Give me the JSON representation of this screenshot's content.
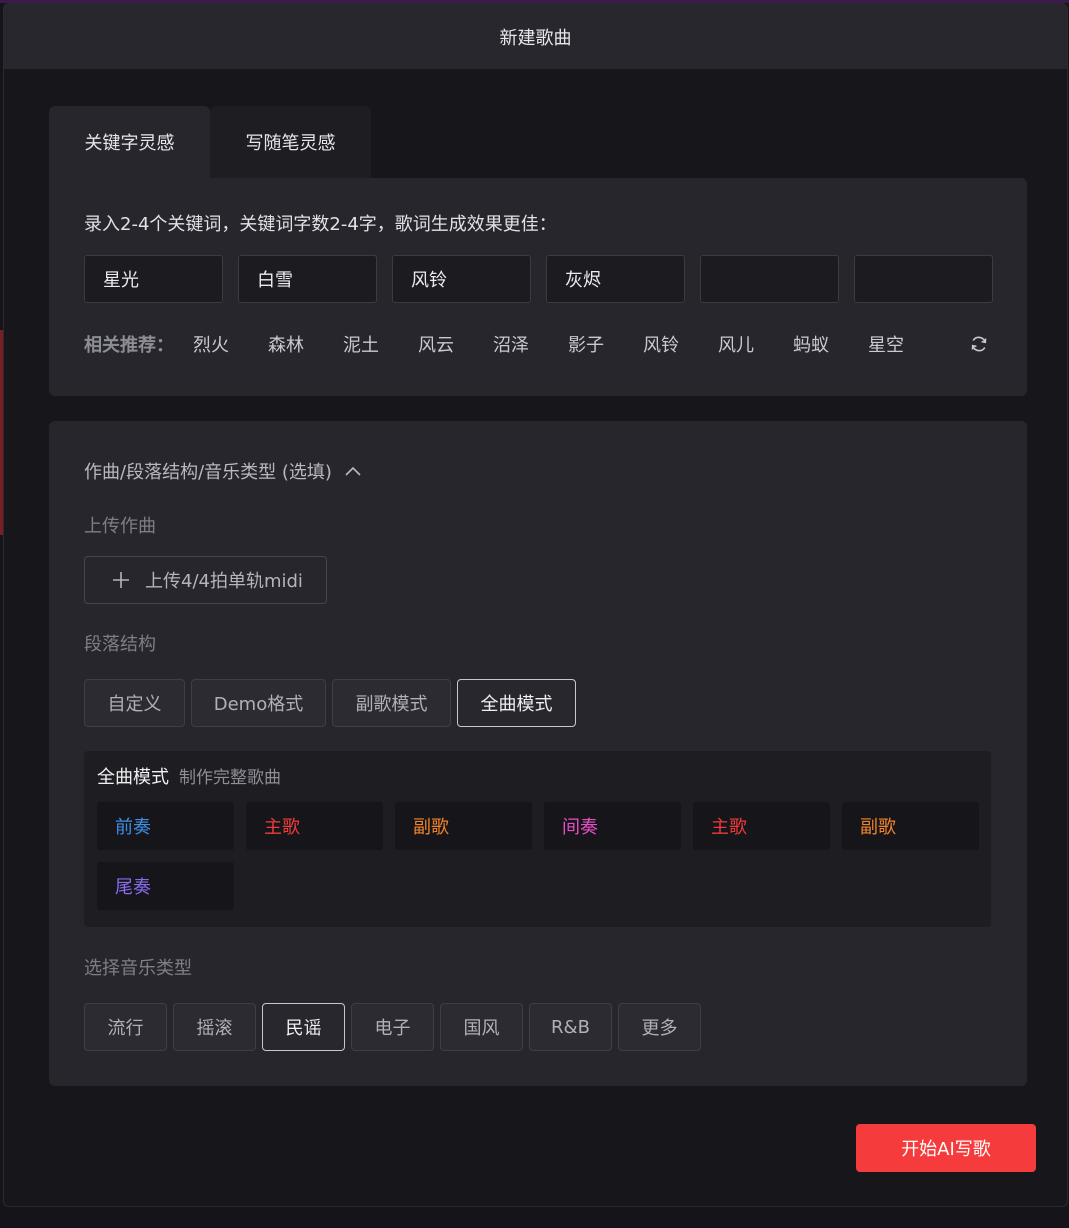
{
  "modal": {
    "title": "新建歌曲"
  },
  "tabs": [
    {
      "label": "关键字灵感",
      "active": true
    },
    {
      "label": "写随笔灵感",
      "active": false
    }
  ],
  "keywords": {
    "hint": "录入2-4个关键词，关键词字数2-4字，歌词生成效果更佳：",
    "values": [
      "星光",
      "白雪",
      "风铃",
      "灰烬",
      "",
      ""
    ]
  },
  "recommend": {
    "label": "相关推荐：",
    "items": [
      "烈火",
      "森林",
      "泥土",
      "风云",
      "沼泽",
      "影子",
      "风铃",
      "风儿",
      "蚂蚁",
      "星空"
    ],
    "refresh_icon": "refresh-icon"
  },
  "options": {
    "section_title": "作曲/段落结构/音乐类型 (选填)",
    "toggle_icon": "chevron-up-icon",
    "upload_label": "上传作曲",
    "upload_button": "上传4/4拍单轨midi",
    "structure_label": "段落结构",
    "structure_modes": [
      {
        "label": "自定义",
        "active": false
      },
      {
        "label": "Demo格式",
        "active": false
      },
      {
        "label": "副歌模式",
        "active": false
      },
      {
        "label": "全曲模式",
        "active": true
      }
    ],
    "structure_title": "全曲模式",
    "structure_desc": "制作完整歌曲",
    "parts": [
      {
        "label": "前奏",
        "color": "#3d8fe8"
      },
      {
        "label": "主歌",
        "color": "#ef3b3b"
      },
      {
        "label": "副歌",
        "color": "#f0842a"
      },
      {
        "label": "间奏",
        "color": "#e84fc7"
      },
      {
        "label": "主歌",
        "color": "#ef3b3b"
      },
      {
        "label": "副歌",
        "color": "#f0842a"
      },
      {
        "label": "尾奏",
        "color": "#8a6cf0"
      }
    ],
    "genre_label": "选择音乐类型",
    "genres": [
      {
        "label": "流行",
        "active": false
      },
      {
        "label": "摇滚",
        "active": false
      },
      {
        "label": "民谣",
        "active": true
      },
      {
        "label": "电子",
        "active": false
      },
      {
        "label": "国风",
        "active": false
      },
      {
        "label": "R&B",
        "active": false
      },
      {
        "label": "更多",
        "active": false
      }
    ]
  },
  "start_button": "开始AI写歌",
  "accent_color": "#f53b3b"
}
